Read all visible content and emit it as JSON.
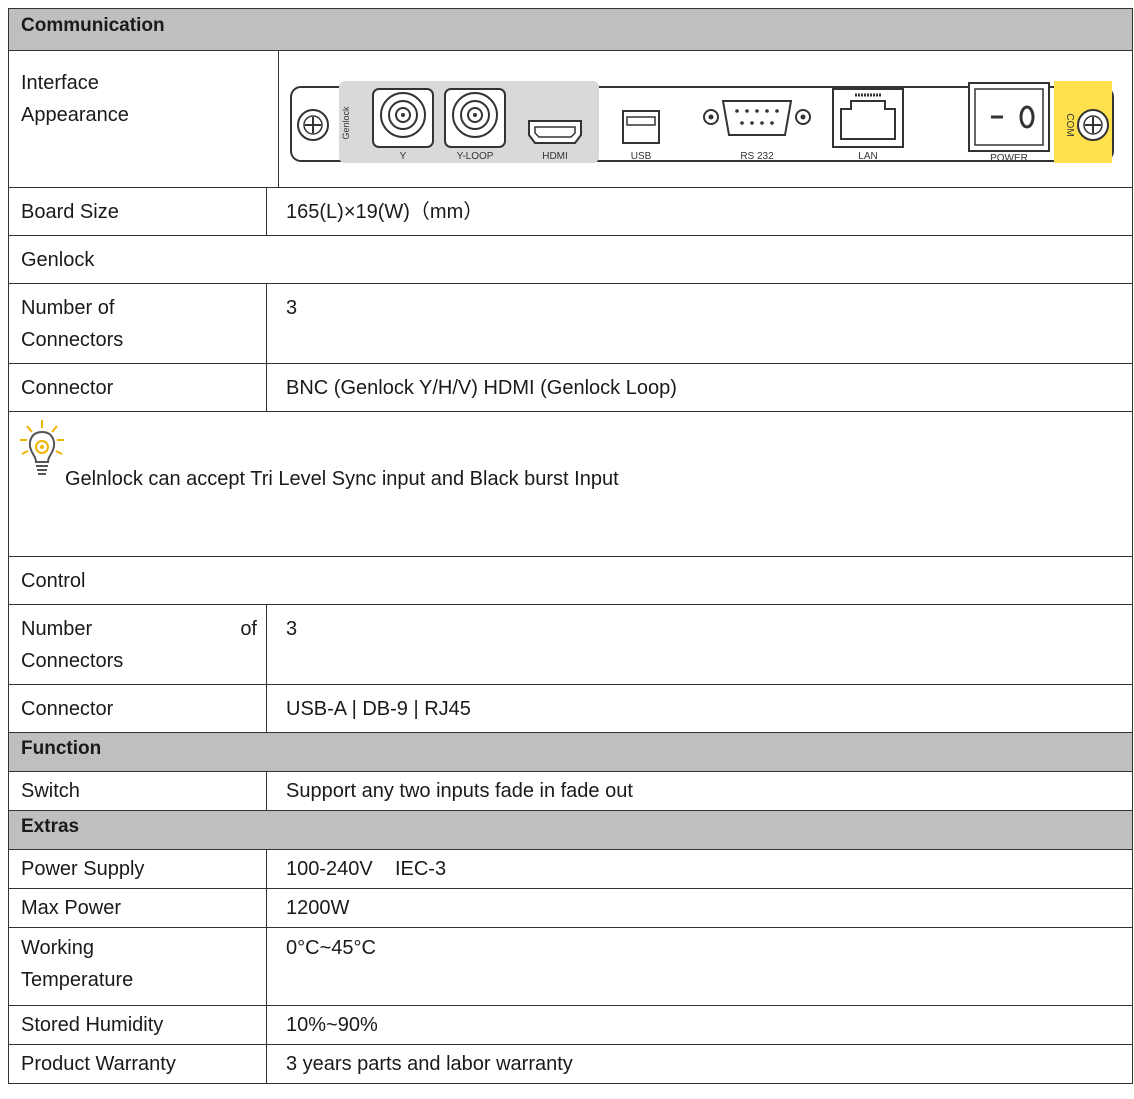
{
  "communication": {
    "header": "Communication",
    "interface_label": "Interface Appearance",
    "interface_label_line1": "Interface",
    "interface_label_line2": "Appearance",
    "panel": {
      "genlock_label": "Genlock",
      "ports": [
        "Y",
        "Y-LOOP",
        "HDMI",
        "USB",
        "RS 232",
        "LAN",
        "POWER"
      ],
      "com_label": "COM",
      "colors": {
        "highlight_gray": "#d9d9d9",
        "com_yellow": "#ffe14d"
      }
    },
    "board_size_label": "Board Size",
    "board_size_value": "165(L)×19(W)（mm）"
  },
  "genlock": {
    "section_label": "Genlock",
    "connectors_count_label_line1": "Number of",
    "connectors_count_label_line2": "Connectors",
    "connectors_count_value": "3",
    "connector_label": "Connector",
    "connector_value": "BNC (Genlock Y/H/V) HDMI (Genlock Loop)",
    "note_icon": "lightbulb-icon",
    "note_text": "Gelnlock can accept Tri Level Sync input and Black burst Input"
  },
  "control": {
    "section_label": "Control",
    "connectors_count_label_word1": "Number",
    "connectors_count_label_word2": "of",
    "connectors_count_label_line2": "Connectors",
    "connectors_count_value": "3",
    "connector_label": "Connector",
    "connector_value": "USB-A | DB-9 | RJ45"
  },
  "function": {
    "header": "Function",
    "switch_label": "Switch",
    "switch_value": "Support any two inputs fade in fade out"
  },
  "extras": {
    "header": "Extras",
    "rows": [
      {
        "label": "Power Supply",
        "value": "100-240V    IEC-3"
      },
      {
        "label": "Max Power",
        "value": "1200W"
      },
      {
        "label_line1": "Working",
        "label_line2": "Temperature",
        "value": "0°C~45°C"
      },
      {
        "label": "Stored Humidity",
        "value": "10%~90%"
      },
      {
        "label": "Product Warranty",
        "value": "3 years parts and labor warranty"
      }
    ]
  }
}
